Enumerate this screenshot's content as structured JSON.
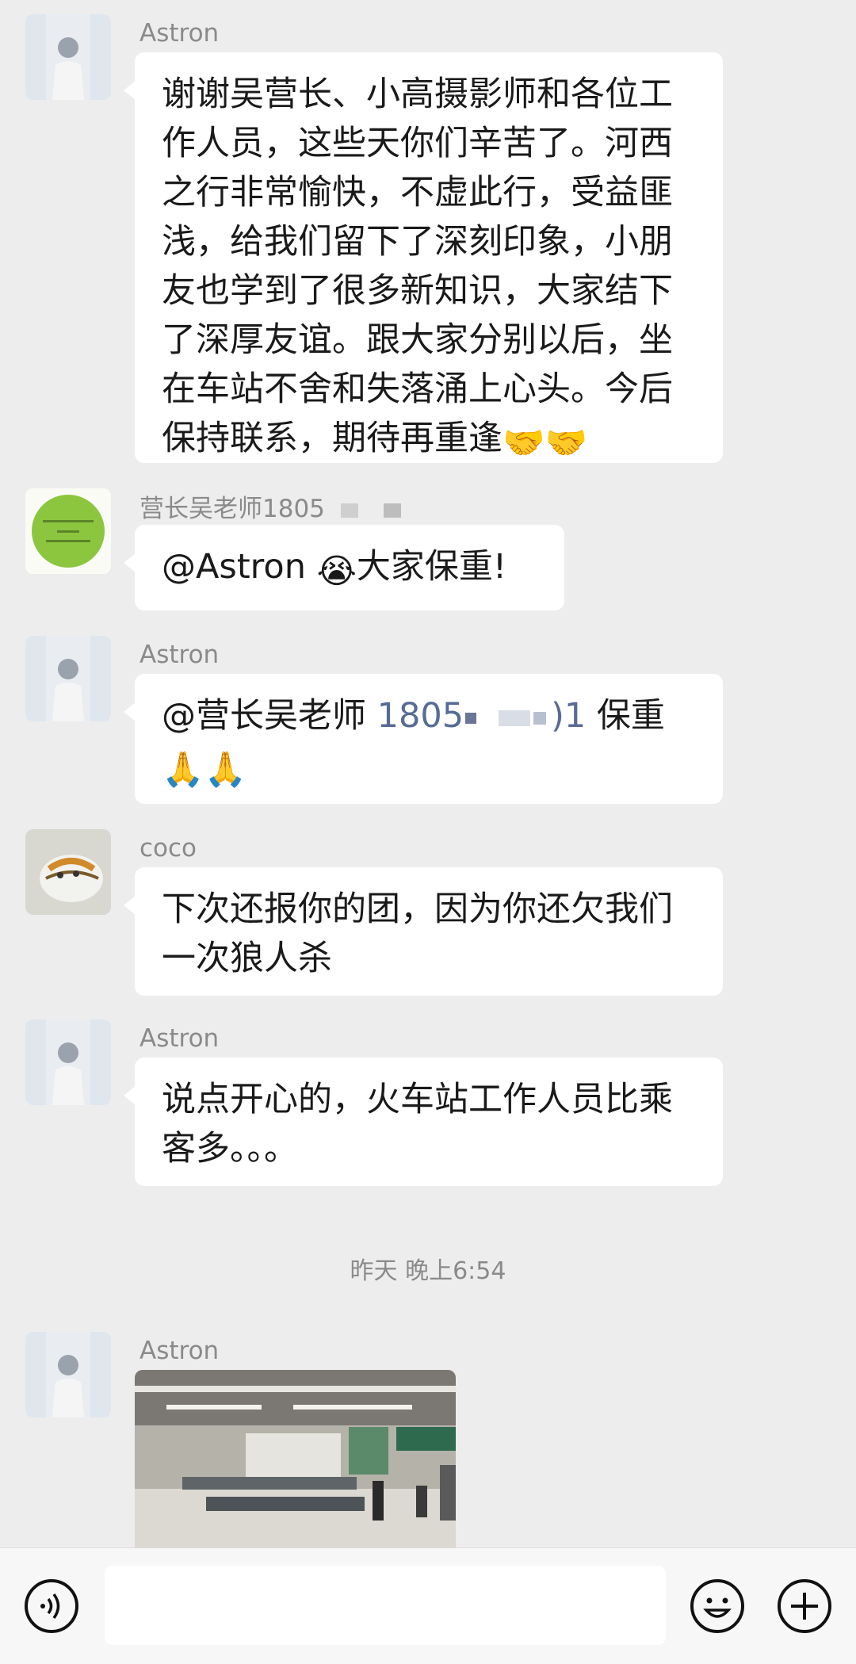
{
  "messages": [
    {
      "sender": "Astron",
      "text": "谢谢吴营长、小高摄影师和各位工\n作人员，这些天你们辛苦了。河西\n之行非常愉快，不虚此行，受益匪\n浅，给我们留下了深刻印象，小朋\n友也学到了很多新知识，大家结下\n了深厚友谊。跟大家分别以后，坐\n在车站不舍和失落涌上心头。今后\n保持联系，期待再重逢",
      "emoji": "🤝🤝"
    },
    {
      "sender": "营长吴老师1805",
      "mention": "@Astron ",
      "emoji": "😭",
      "text": "大家保重!"
    },
    {
      "sender": "Astron",
      "mention": "@营长吴老师 ",
      "number_start": "1805",
      "number_end": ")1",
      "text": " 保重",
      "emoji": "🙏🙏"
    },
    {
      "sender": "coco",
      "text": "下次还报你的团，因为你还欠我们\n一次狼人杀"
    },
    {
      "sender": "Astron",
      "text": "说点开心的，火车站工作人员比乘\n客多。。。"
    },
    {
      "sender": "Astron"
    }
  ],
  "timestamp": "昨天 晚上6:54",
  "colors": {
    "background": "#ededed",
    "bubble": "#ffffff",
    "sender_name": "#8a8a8a",
    "link_number": "#576b95",
    "avatar_green": "#8cc63f"
  },
  "icons": {
    "voice": "voice-input-icon",
    "emoji": "emoji-icon",
    "more": "plus-icon"
  }
}
